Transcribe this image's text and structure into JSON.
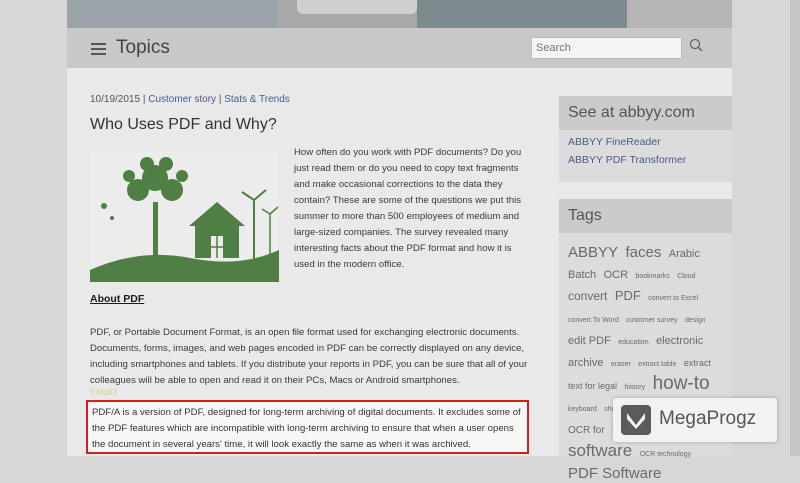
{
  "header": {
    "title": "Topics",
    "search_placeholder": "Search"
  },
  "article": {
    "date": "10/19/2015",
    "sep": "|",
    "categories": [
      "Customer story",
      "Stats & Trends"
    ],
    "title": "Who Uses PDF and Why?",
    "intro": "How often do you work with PDF documents? Do you just read them or do you need to copy text fragments and make occasional corrections to the data they contain? These are some of the questions we put this summer to more than 500 employees of medium and large-sized companies. The survey revealed many interesting facts about the PDF format and how it is used in the modern office.",
    "subheading": "About PDF",
    "paragraph1": "PDF, or Portable Document Format, is an open file format used for exchanging electronic documents. Documents, forms, images, and web pages encoded in PDF can be correctly displayed on any device, including smartphones and tablets. If you distribute your reports in PDF, you can be sure that all of your colleagues will be able to open and read it on their PCs, Macs or Android smartphones.",
    "overlay_label": "678d83",
    "highlighted_paragraph": "PDF/A is a version of PDF, designed for long-term archiving of digital documents. It excludes some of the PDF features which are incompatible with long-term archiving to ensure that when a user opens the document in several years' time, it will look exactly the same as when it was archived."
  },
  "sidebar": {
    "see_title": "See at abbyy.com",
    "see_links": [
      "ABBYY FineReader",
      "ABBYY PDF Transformer"
    ],
    "tags_title": "Tags",
    "tags": [
      {
        "text": "ABBYY",
        "size": 15
      },
      {
        "text": "faces",
        "size": 15
      },
      {
        "text": "Arabic",
        "size": 11
      },
      {
        "text": "Batch",
        "size": 11
      },
      {
        "text": "OCR",
        "size": 11
      },
      {
        "text": "bookmarks",
        "size": 7
      },
      {
        "text": "Cloud",
        "size": 7
      },
      {
        "text": "convert",
        "size": 12
      },
      {
        "text": "PDF",
        "size": 13
      },
      {
        "text": "convert to Excel",
        "size": 7
      },
      {
        "text": "convert To Word",
        "size": 7
      },
      {
        "text": "customer survey",
        "size": 7
      },
      {
        "text": "design",
        "size": 7
      },
      {
        "text": "edit PDF",
        "size": 11
      },
      {
        "text": "education",
        "size": 7
      },
      {
        "text": "electronic archive",
        "size": 11
      },
      {
        "text": "eraser",
        "size": 7
      },
      {
        "text": "extract table",
        "size": 7
      },
      {
        "text": "extract text for legal",
        "size": 9
      },
      {
        "text": "history",
        "size": 7
      },
      {
        "text": "how-to",
        "size": 19
      },
      {
        "text": "keyboard",
        "size": 7
      },
      {
        "text": "shortcuts",
        "size": 7
      },
      {
        "text": "knowledge base",
        "size": 7
      },
      {
        "text": "legal",
        "size": 7
      },
      {
        "text": "OCR for",
        "size": 10
      },
      {
        "text": "Mac",
        "size": 10
      },
      {
        "text": "OCR",
        "size": 7
      },
      {
        "text": "software",
        "size": 17
      },
      {
        "text": "OCR technology",
        "size": 7
      },
      {
        "text": "PDF Software",
        "size": 15
      }
    ]
  },
  "watermark": {
    "text": "MegaProgz"
  },
  "colors": {
    "link": "#4a5a8a",
    "highlight_border": "#d21f1f",
    "tree_green": "#4f7f44"
  }
}
